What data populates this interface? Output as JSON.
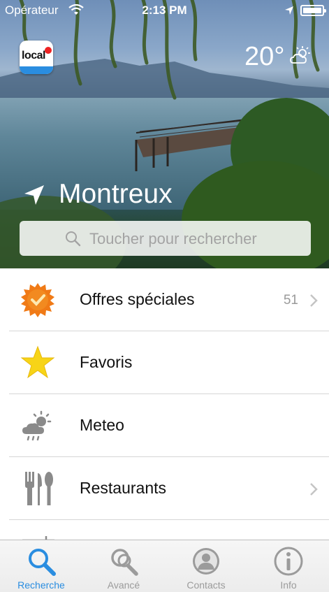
{
  "status_bar": {
    "carrier": "Opérateur",
    "time": "2:13 PM"
  },
  "header": {
    "logo_text": "local",
    "temperature": "20°",
    "weather_icon": "partly-cloudy-icon",
    "city": "Montreux",
    "search_placeholder": "Toucher pour rechercher"
  },
  "menu": [
    {
      "label": "Offres spéciales",
      "count": "51",
      "icon": "special-offer-badge-icon",
      "has_chevron": true
    },
    {
      "label": "Favoris",
      "count": "",
      "icon": "star-icon",
      "has_chevron": false
    },
    {
      "label": "Meteo",
      "count": "",
      "icon": "weather-cloud-icon",
      "has_chevron": false
    },
    {
      "label": "Restaurants",
      "count": "",
      "icon": "cutlery-icon",
      "has_chevron": true
    },
    {
      "label": "",
      "count": "",
      "icon": "lodging-icon",
      "has_chevron": false
    }
  ],
  "tab_bar": {
    "active_tab": "Recherche",
    "tabs": [
      {
        "label": "Recherche",
        "icon": "search-icon"
      },
      {
        "label": "Avancé",
        "icon": "advanced-search-icon"
      },
      {
        "label": "Contacts",
        "icon": "contact-icon"
      },
      {
        "label": "Info",
        "icon": "info-icon"
      }
    ]
  },
  "colors": {
    "accent": "#2a8de0",
    "inactive": "#9b9b9b",
    "star": "#f7d417",
    "badge": "#f07a16"
  }
}
